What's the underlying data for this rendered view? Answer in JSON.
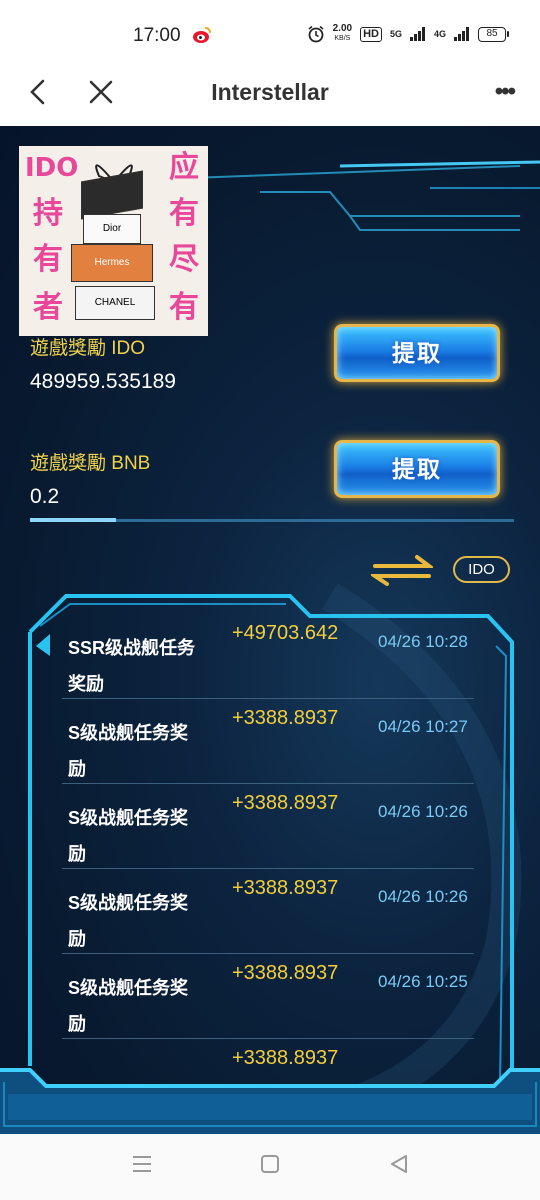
{
  "status_bar": {
    "time": "17:00",
    "speed_value": "2.00",
    "speed_unit": "KB/S",
    "hd_label": "HD",
    "network_a": "5G",
    "network_b": "4G",
    "battery": "85"
  },
  "nav": {
    "title": "Interstellar",
    "more_label": "•••"
  },
  "ad": {
    "left_chars": [
      "IDO",
      "持",
      "有",
      "者"
    ],
    "right_chars": [
      "应",
      "有",
      "尽",
      "有"
    ],
    "boxes": [
      "Dior",
      "Hermes",
      "CHANEL"
    ]
  },
  "rewards": {
    "ido_label": "遊戲獎勵 IDO",
    "ido_value": "489959.535189",
    "bnb_label": "遊戲獎勵 BNB",
    "bnb_value": "0.2",
    "claim_label": "提取"
  },
  "coin_selector": "IDO",
  "records": [
    {
      "title": "SSR级战舰任务奖励",
      "amount": "+49703.642",
      "time": "04/26 10:28"
    },
    {
      "title": "S级战舰任务奖励",
      "amount": "+3388.8937",
      "time": "04/26 10:27"
    },
    {
      "title": "S级战舰任务奖励",
      "amount": "+3388.8937",
      "time": "04/26 10:26"
    },
    {
      "title": "S级战舰任务奖励",
      "amount": "+3388.8937",
      "time": "04/26 10:26"
    },
    {
      "title": "S级战舰任务奖励",
      "amount": "+3388.8937",
      "time": "04/26 10:25"
    },
    {
      "title": "",
      "amount": "+3388.8937",
      "time": ""
    }
  ],
  "colors": {
    "gold": "#f0d24a",
    "amount": "#f3cd3a",
    "time": "#7bcaf5",
    "frame": "#29c3f2"
  }
}
